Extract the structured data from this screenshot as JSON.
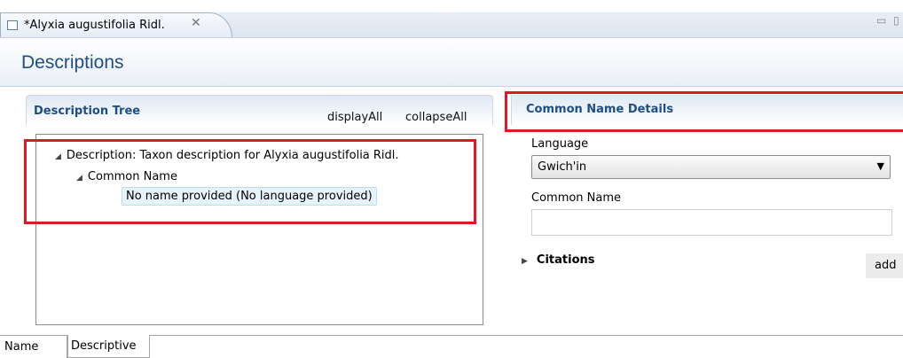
{
  "editor_tab": {
    "title": "*Alyxia augustifolia Ridl.",
    "close_icon": "close-icon",
    "window_controls": "▭ ▯"
  },
  "page": {
    "title": "Descriptions"
  },
  "description_tree": {
    "title": "Description Tree",
    "display_all": "displayAll",
    "collapse_all": "collapseAll",
    "nodes": [
      {
        "expander": "◢",
        "label": "Description: Taxon description for Alyxia augustifolia Ridl."
      },
      {
        "expander": "◢",
        "label": "Common Name"
      }
    ],
    "selected_node": "No name provided (No language provided)"
  },
  "details": {
    "title": "Common Name Details",
    "language_label": "Language",
    "language_value": "Gwich'in",
    "language_arrow": "▼",
    "common_name_label": "Common Name",
    "common_name_value": "",
    "citations_expander": "▶",
    "citations_label": "Citations",
    "add_label": "add"
  },
  "bottom_tabs": [
    "Name",
    "Descriptive"
  ],
  "colors": {
    "accent": "#1d4f86",
    "highlight_border": "#e0191e",
    "selection_bg": "#e6f3fb"
  }
}
